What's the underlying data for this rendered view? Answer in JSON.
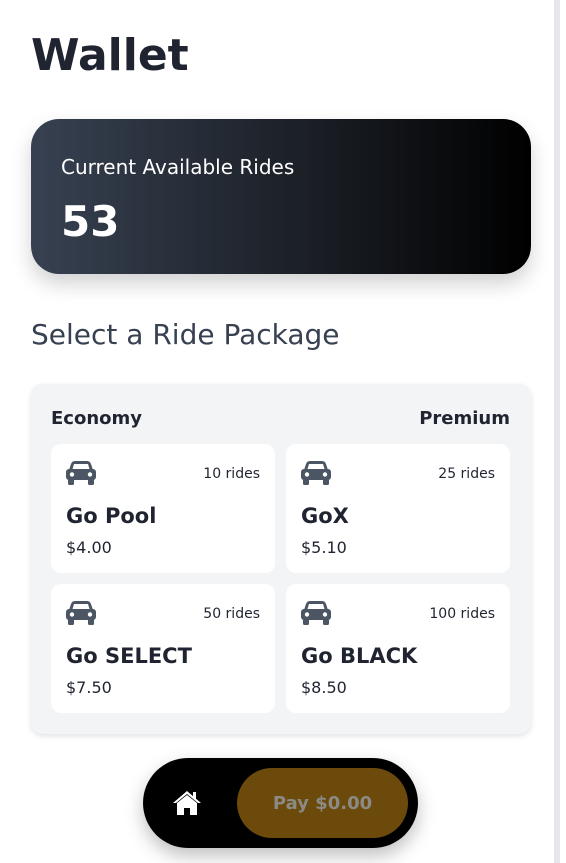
{
  "header": {
    "title": "Wallet"
  },
  "balance": {
    "label": "Current Available Rides",
    "value": "53",
    "gradient_start": "#374151",
    "gradient_end": "#000000"
  },
  "packages_section": {
    "title": "Select a Ride Package",
    "tiers": {
      "left": "Economy",
      "right": "Premium"
    },
    "packages": [
      {
        "name": "Go Pool",
        "price": "$4.00",
        "rides": "10 rides",
        "icon": "car-icon"
      },
      {
        "name": "GoX",
        "price": "$5.10",
        "rides": "25 rides",
        "icon": "car-icon"
      },
      {
        "name": "Go SELECT",
        "price": "$7.50",
        "rides": "50 rides",
        "icon": "car-icon"
      },
      {
        "name": "Go BLACK",
        "price": "$8.50",
        "rides": "100 rides",
        "icon": "car-icon"
      }
    ]
  },
  "bottom_bar": {
    "home_icon": "home-icon",
    "pay_label": "Pay $0.00",
    "pay_color": "#6b4a0b"
  }
}
